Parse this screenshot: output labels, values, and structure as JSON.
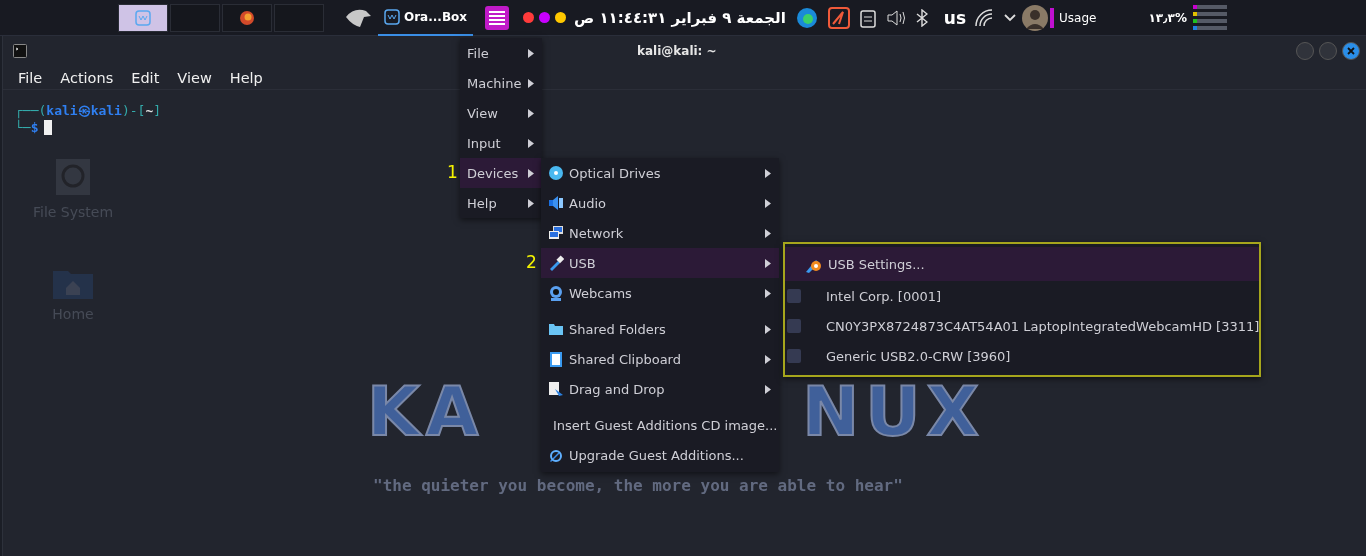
{
  "top_bar": {
    "workspaces": [
      {
        "selected": true
      },
      {
        "selected": false
      },
      {
        "selected": false
      },
      {
        "selected": false
      }
    ],
    "task": {
      "label": "Ora...Box"
    },
    "dots": [
      {
        "color": "#ff3b3b"
      },
      {
        "color": "#c800ff"
      },
      {
        "color": "#ffc800"
      }
    ],
    "clock": "الجمعة ٩ فبراير ١١:٤٤:٣١ ص",
    "keyboard": "us",
    "usage_label": "Usage",
    "usage_value": "١٣٫٣%",
    "meters": [
      {
        "color": "#c800d0",
        "level": 0.12
      },
      {
        "color": "#e0c000",
        "level": 0.12
      },
      {
        "color": "#20c020",
        "level": 0.12
      },
      {
        "color": "#2080e0",
        "level": 0.12
      }
    ]
  },
  "desktop": {
    "icons": [
      {
        "label": "File System",
        "kind": "drive"
      },
      {
        "label": "Home",
        "kind": "folder"
      }
    ],
    "logo_left": "KA",
    "logo_right": "NUX",
    "tagline": "\"the quieter you become, the more you are able to hear\""
  },
  "terminal": {
    "title": "kali@kali: ~",
    "menu": [
      "File",
      "Actions",
      "Edit",
      "View",
      "Help"
    ],
    "prompt": {
      "corner_top": "┌──",
      "open": "(",
      "user": "kali",
      "at": "㉿",
      "host": "kali",
      "close": ")-[",
      "dir": "~",
      "end": "]",
      "corner_bottom": "└─",
      "symbol": "$"
    }
  },
  "vbox_menu": {
    "items": [
      {
        "label": "File",
        "selected": false
      },
      {
        "label": "Machine",
        "selected": false
      },
      {
        "label": "View",
        "selected": false
      },
      {
        "label": "Input",
        "selected": false
      },
      {
        "label": "Devices",
        "selected": true,
        "marker": "1"
      },
      {
        "label": "Help",
        "selected": false
      }
    ]
  },
  "devices_menu": {
    "items": [
      {
        "label": "Optical Drives",
        "submenu": true,
        "selected": false
      },
      {
        "label": "Audio",
        "submenu": true,
        "selected": false
      },
      {
        "label": "Network",
        "submenu": true,
        "selected": false
      },
      {
        "label": "USB",
        "submenu": true,
        "selected": true,
        "marker": "2"
      },
      {
        "label": "Webcams",
        "submenu": true,
        "selected": false
      },
      {
        "kind": "separator"
      },
      {
        "label": "Shared Folders",
        "submenu": true,
        "selected": false
      },
      {
        "label": "Shared Clipboard",
        "submenu": true,
        "selected": false
      },
      {
        "label": "Drag and Drop",
        "submenu": true,
        "selected": false
      },
      {
        "kind": "separator"
      },
      {
        "label": "Insert Guest Additions CD image...",
        "submenu": false,
        "selected": false
      },
      {
        "label": "Upgrade Guest Additions...",
        "submenu": false,
        "selected": false
      }
    ]
  },
  "usb_menu": {
    "settings": {
      "label": "USB Settings...",
      "selected": true
    },
    "devices": [
      {
        "label": "Intel Corp.  [0001]",
        "checked": false
      },
      {
        "label": "CN0Y3PX8724873C4AT54A01 LaptopIntegratedWebcamHD [3311]",
        "checked": false
      },
      {
        "label": "Generic USB2.0-CRW [3960]",
        "checked": false
      }
    ]
  }
}
